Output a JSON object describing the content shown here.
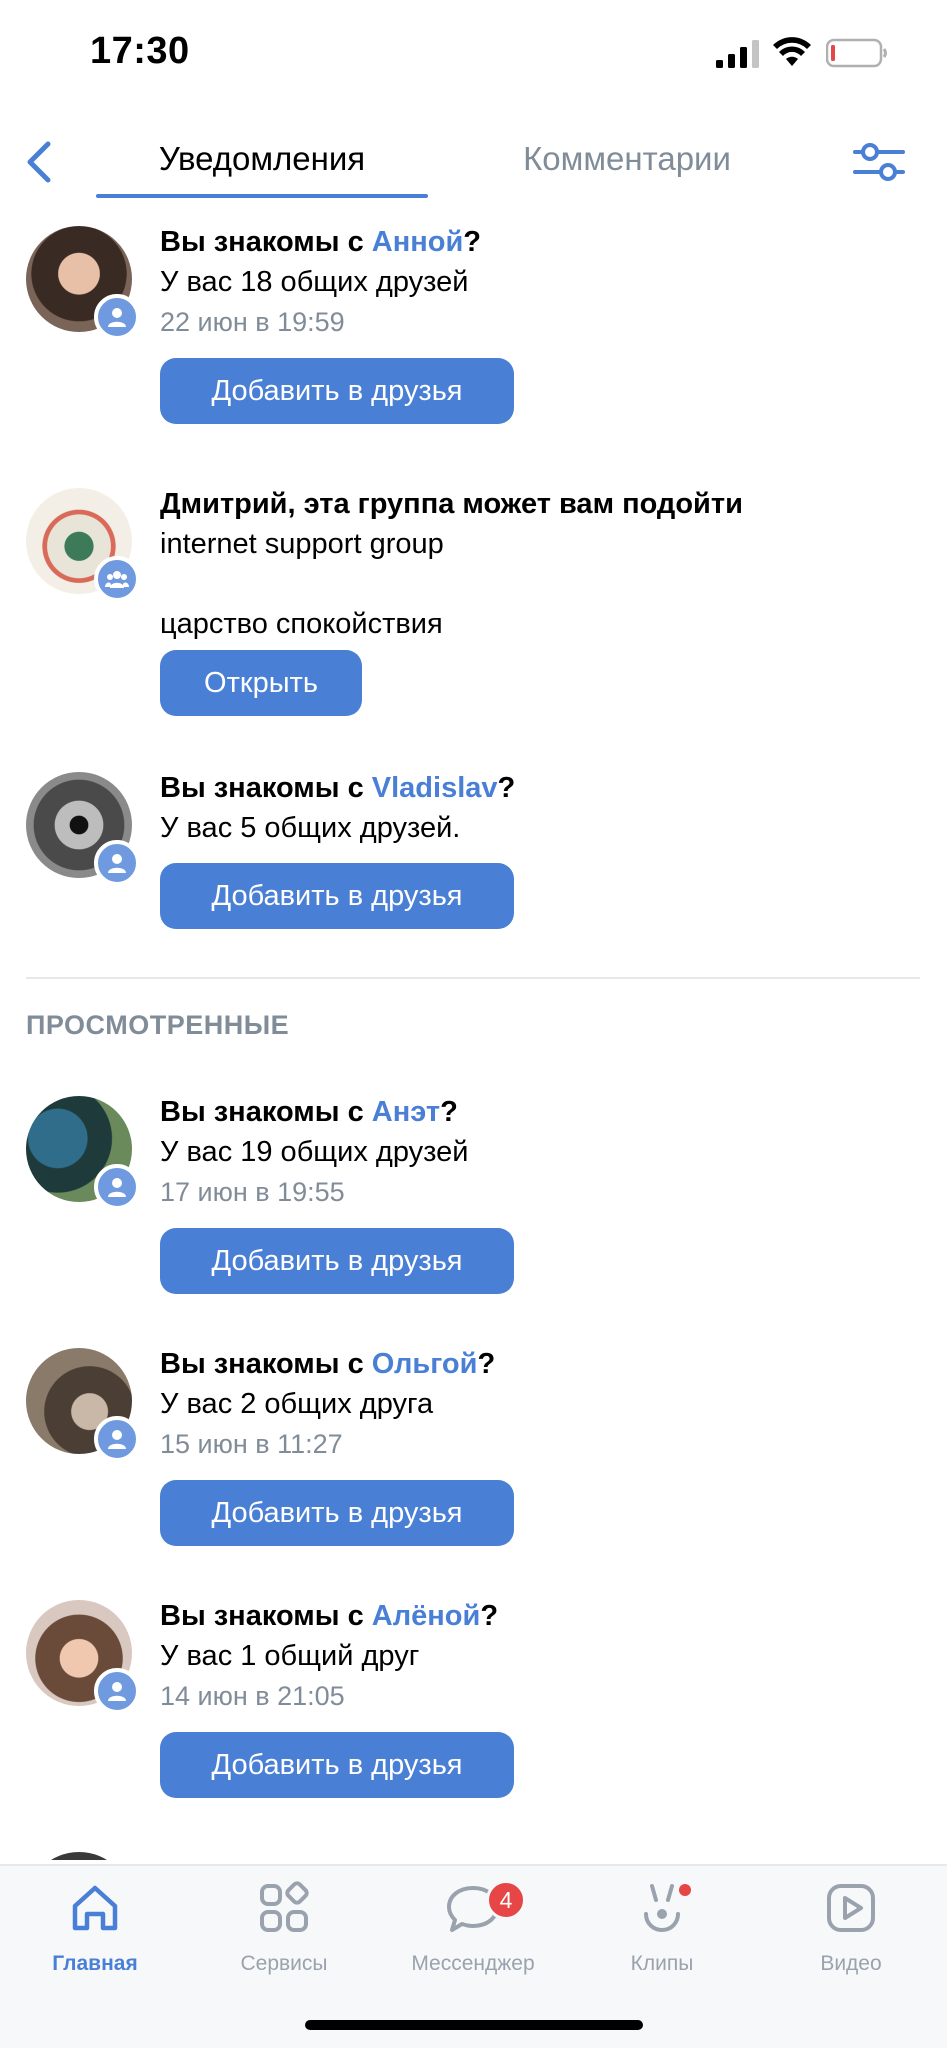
{
  "status_bar": {
    "time": "17:30"
  },
  "header": {
    "tabs": [
      {
        "label": "Уведомления",
        "active": true
      },
      {
        "label": "Комментарии",
        "active": false
      }
    ]
  },
  "notifications": [
    {
      "prefix": "Вы знакомы с ",
      "name": "Анной",
      "suffix": "?",
      "subtitle": "У вас 18 общих друзей",
      "date": "22 июн в 19:59",
      "button": "Добавить в друзья",
      "badge": "user-icon"
    },
    {
      "title": "Дмитрий, эта группа может вам подойти",
      "group_name": "internet support group",
      "group_desc": "царство спокойствия",
      "button": "Открыть",
      "badge": "group-icon"
    },
    {
      "prefix": "Вы знакомы с ",
      "name": "Vladislav",
      "suffix": "?",
      "subtitle": "У вас 5 общих друзей.",
      "button": "Добавить в друзья",
      "badge": "user-icon"
    }
  ],
  "viewed_section": {
    "title": "ПРОСМОТРЕННЫЕ"
  },
  "viewed": [
    {
      "prefix": "Вы знакомы с ",
      "name": "Анэт",
      "suffix": "?",
      "subtitle": "У вас 19 общих друзей",
      "date": "17 июн в 19:55",
      "button": "Добавить в друзья"
    },
    {
      "prefix": "Вы знакомы с ",
      "name": "Ольгой",
      "suffix": "?",
      "subtitle": "У вас 2 общих друга",
      "date": "15 июн в 11:27",
      "button": "Добавить в друзья"
    },
    {
      "prefix": "Вы знакомы с ",
      "name": "Алёной",
      "suffix": "?",
      "subtitle": "У вас 1 общий друг",
      "date": "14 июн в 21:05",
      "button": "Добавить в друзья"
    }
  ],
  "tabbar": {
    "items": [
      {
        "label": "Главная",
        "icon": "home-icon",
        "active": true
      },
      {
        "label": "Сервисы",
        "icon": "services-icon",
        "active": false
      },
      {
        "label": "Мессенджер",
        "icon": "messenger-icon",
        "active": false,
        "badge": "4"
      },
      {
        "label": "Клипы",
        "icon": "clips-icon",
        "active": false,
        "dot": true
      },
      {
        "label": "Видео",
        "icon": "video-icon",
        "active": false
      }
    ]
  },
  "colors": {
    "accent": "#4a7fd6",
    "secondary_text": "#818c99",
    "badge_red": "#e64646"
  }
}
